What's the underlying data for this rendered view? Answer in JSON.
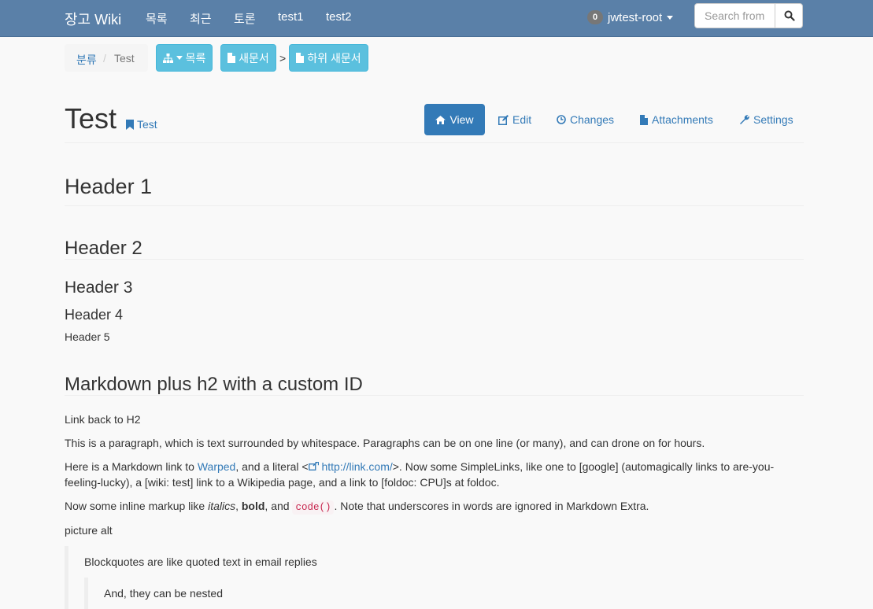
{
  "navbar": {
    "brand": "장고 Wiki",
    "links": [
      "목록",
      "최근",
      "토론",
      "test1",
      "test2"
    ],
    "notifications": "0",
    "user": "jwtest-root",
    "search_placeholder": "Search from here"
  },
  "breadcrumb": {
    "category": "분류",
    "separator": "/",
    "current": "Test",
    "list_button": "목록",
    "new_doc_button": "새문서",
    "arrow": ">",
    "child_doc_button": "하위 새문서"
  },
  "page": {
    "title": "Test",
    "tag": "Test",
    "tabs": [
      "View",
      "Edit",
      "Changes",
      "Attachments",
      "Settings"
    ]
  },
  "content": {
    "h1": "Header 1",
    "h2": "Header 2",
    "h3": "Header 3",
    "h4": "Header 4",
    "h5": "Header 5",
    "h2_custom": "Markdown plus h2 with a custom ID",
    "link_back": "Link back to H2",
    "para1": "This is a paragraph, which is text surrounded by whitespace. Paragraphs can be on one line (or many), and can drone on for hours.",
    "para2_a": "Here is a Markdown link to ",
    "para2_link": "Warped",
    "para2_b": ", and a literal <",
    "para2_url": "http://link.com/",
    "para2_c": ">. Now some SimpleLinks, like one to [google] (automagically links to are-you-feeling-lucky), a [wiki: test] link to a Wikipedia page, and a link to [foldoc: CPU]s at foldoc.",
    "para3_a": "Now some inline markup like ",
    "para3_italic": "italics",
    "para3_b": ", ",
    "para3_bold": "bold",
    "para3_c": ", and ",
    "para3_code": "code()",
    "para3_d": ". Note that underscores in words are ignored in Markdown Extra.",
    "picture_alt": "picture alt",
    "blockquote1": "Blockquotes are like quoted text in email replies",
    "blockquote2": "And, they can be nested"
  },
  "colors": {
    "navbar": "#5a80a8",
    "info_button": "#5bc0de",
    "primary": "#337ab7"
  }
}
